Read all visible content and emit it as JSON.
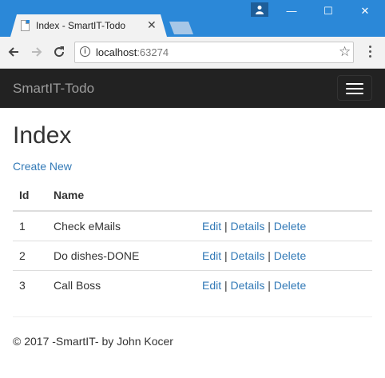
{
  "browser": {
    "tab_title": "Index - SmartIT-Todo",
    "url_host": "localhost",
    "url_port": ":63274",
    "tab_close": "✕",
    "minimize": "—",
    "maximize": "☐",
    "close": "✕"
  },
  "navbar": {
    "brand": "SmartIT-Todo"
  },
  "page": {
    "title": "Index",
    "create_link": "Create New",
    "table": {
      "headers": [
        "Id",
        "Name"
      ],
      "rows": [
        {
          "id": "1",
          "name": "Check eMails"
        },
        {
          "id": "2",
          "name": "Do dishes-DONE"
        },
        {
          "id": "3",
          "name": "Call Boss"
        }
      ],
      "actions": {
        "edit": "Edit",
        "details": "Details",
        "delete": "Delete",
        "sep": "|"
      }
    },
    "footer": "© 2017 -SmartIT- by John Kocer"
  },
  "colors": {
    "titlebar": "#2b88d8",
    "navbar": "#222222",
    "link": "#337ab7"
  },
  "icons": {
    "back": "arrow-left-icon",
    "forward": "arrow-right-icon",
    "reload": "reload-icon",
    "info": "info-icon",
    "bookmark": "star-icon",
    "menu": "more-vert-icon",
    "profile": "person-icon"
  }
}
